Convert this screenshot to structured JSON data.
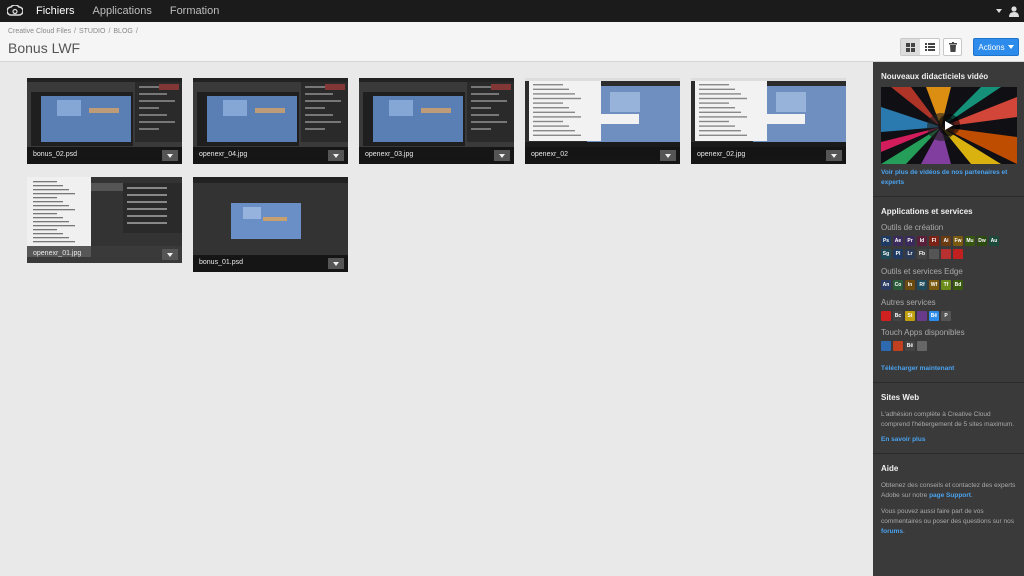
{
  "nav": {
    "items": [
      "Fichiers",
      "Applications",
      "Formation"
    ]
  },
  "header": {
    "breadcrumb": [
      "Creative Cloud Files",
      "STUDIO",
      "BLOG"
    ],
    "title": "Bonus LWF",
    "actions_label": "Actions"
  },
  "files": [
    {
      "name": "bonus_02.psd",
      "kind": "ps"
    },
    {
      "name": "openexr_04.jpg",
      "kind": "ps"
    },
    {
      "name": "openexr_03.jpg",
      "kind": "ps"
    },
    {
      "name": "openexr_02",
      "kind": "menu"
    },
    {
      "name": "openexr_02.jpg",
      "kind": "menu"
    },
    {
      "name": "openexr_01.jpg",
      "kind": "menu2"
    },
    {
      "name": "bonus_01.psd",
      "kind": "dark"
    }
  ],
  "sidebar": {
    "videos": {
      "title": "Nouveaux didacticiels vidéo",
      "link": "Voir plus de vidéos de nos partenaires et experts"
    },
    "apps": {
      "title": "Applications et services",
      "creation_label": "Outils de création",
      "creation_row1": [
        {
          "t": "Ps",
          "bg": "#1f3b63"
        },
        {
          "t": "Ae",
          "bg": "#3b2a5c"
        },
        {
          "t": "Pr",
          "bg": "#3b2a5c"
        },
        {
          "t": "Id",
          "bg": "#5a1f3a"
        },
        {
          "t": "Fl",
          "bg": "#7a2316"
        },
        {
          "t": "Ai",
          "bg": "#6a3a10"
        },
        {
          "t": "Fw",
          "bg": "#7a5a10"
        },
        {
          "t": "Mu",
          "bg": "#355510"
        },
        {
          "t": "Dw",
          "bg": "#2c4a10"
        },
        {
          "t": "Au",
          "bg": "#1c4a3a"
        }
      ],
      "creation_row2": [
        {
          "t": "Sg",
          "bg": "#1f4a5a"
        },
        {
          "t": "Pl",
          "bg": "#1f3b63"
        },
        {
          "t": "Lr",
          "bg": "#2b3b55"
        },
        {
          "t": "Fb",
          "bg": "#444444"
        },
        {
          "t": "",
          "bg": "#555555"
        },
        {
          "t": "",
          "bg": "#b83030"
        },
        {
          "t": "",
          "bg": "#c02020"
        }
      ],
      "edge_label": "Outils et services Edge",
      "edge_row": [
        {
          "t": "An",
          "bg": "#2b3b63"
        },
        {
          "t": "Co",
          "bg": "#2b5a3a"
        },
        {
          "t": "In",
          "bg": "#6a4a10"
        },
        {
          "t": "Rf",
          "bg": "#1f4a5a"
        },
        {
          "t": "Wf",
          "bg": "#7a5a10"
        },
        {
          "t": "Tf",
          "bg": "#6a8a1a"
        },
        {
          "t": "Bd",
          "bg": "#3a5a10"
        }
      ],
      "other_label": "Autres services",
      "other_row": [
        {
          "t": "",
          "bg": "#d02020"
        },
        {
          "t": "Bc",
          "bg": "#444444"
        },
        {
          "t": "St",
          "bg": "#c0a010"
        },
        {
          "t": "",
          "bg": "#6a3a8a"
        },
        {
          "t": "Bē",
          "bg": "#2d8ceb"
        },
        {
          "t": "P",
          "bg": "#555555"
        }
      ],
      "touch_label": "Touch Apps disponibles",
      "touch_row": [
        {
          "t": "",
          "bg": "#2d6ab0"
        },
        {
          "t": "",
          "bg": "#c04020"
        },
        {
          "t": "Bē",
          "bg": "#444444"
        },
        {
          "t": "",
          "bg": "#666666"
        }
      ],
      "download_link": "Télécharger maintenant"
    },
    "sites": {
      "title": "Sites Web",
      "text": "L'adhésion complète à Creative Cloud comprend l'hébergement de 5 sites maximum.",
      "link": "En savoir plus"
    },
    "help": {
      "title": "Aide",
      "text1_pre": "Obtenez des conseils et contactez des experts Adobe sur notre ",
      "text1_link": "page Support",
      "text1_post": ".",
      "text2_pre": "Vous pouvez aussi faire part de vos commentaires ou poser des questions sur nos ",
      "text2_link": "forums",
      "text2_post": "."
    }
  }
}
